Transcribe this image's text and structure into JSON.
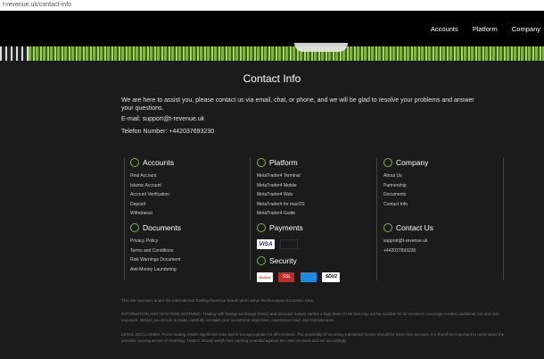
{
  "url": "t-revenue.uk/contact-info",
  "nav": {
    "accounts": "Accounts",
    "platform": "Platform",
    "company": "Company"
  },
  "title": "Contact Info",
  "intro": "We are here to assist you, please contact us via email, chat, or phone, and we will be glad to resolve your problems and answer your questions.",
  "email": "E-mail:  support@t-revenue.uk",
  "phone": "Telefon Number: +442037693230",
  "accounts": {
    "heading": "Accounts",
    "items": [
      "Real Account",
      "Islamic Account",
      "Account Verification",
      "Deposit",
      "Withdrawal"
    ]
  },
  "platform": {
    "heading": "Platform",
    "items": [
      "MetaTrader4 Terminal",
      "MetaTrader4 Mobile",
      "MetaTrader4 Web",
      "MetaTrader4 for macOS",
      "MetaTrader4 Guide"
    ]
  },
  "company": {
    "heading": "Company",
    "items": [
      "About Us",
      "Partnership",
      "Documents",
      "Contact Info"
    ]
  },
  "documents": {
    "heading": "Documents",
    "items": [
      "Privacy Policy",
      "Terms and Conditions",
      "Risk Warnings Document",
      "Anti-Money Laundering"
    ]
  },
  "payments": {
    "heading": "Payments",
    "badges": [
      "VISA",
      ""
    ]
  },
  "contact_us": {
    "heading": "Contact Us",
    "items": [
      "support@t-revenue.uk",
      "+442037693230"
    ]
  },
  "security": {
    "heading": "Security",
    "badges": [
      "McAfee",
      "SSL",
      "",
      "SDV2"
    ]
  },
  "footer": {
    "operator": "This site operates under the International Trading Revenue brand name within the European Economic Area.",
    "risk": "INFORMATION AND HIGH RISK WARNING: Trading with foreign exchange (forex) and precious metals carries a high level of risk that may not be suitable for all investors. Leverage creates additional risk and loss exposure. Before you decide to trade, carefully consider your investment objectives, experience level, and risk tolerance.",
    "legal": "LEGAL DISCLAIMER: Forex trading entails significant risks and is not appropriate for all investors. The possibility of incurring substantial losses should be taken into account. It is therefore important to understand the possible consequences of investing. Traders should weigh their earning potential against the risks involved and act accordingly."
  },
  "colors": {
    "accent": "#7cb342"
  }
}
